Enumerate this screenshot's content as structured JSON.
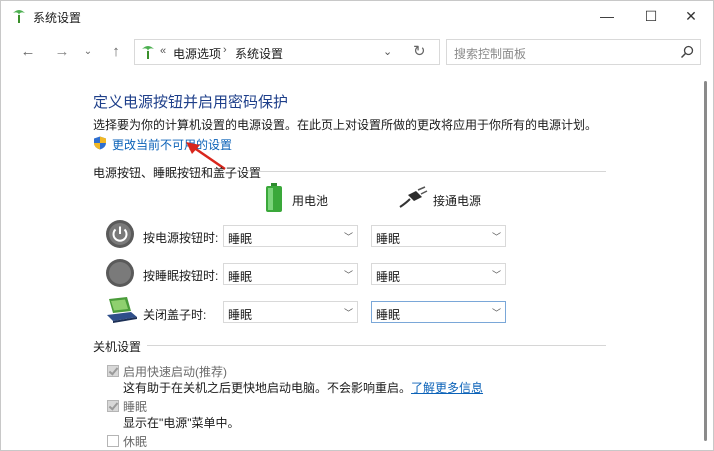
{
  "window": {
    "title": "系统设置"
  },
  "titlebar": {
    "minimize": "—",
    "maximize": "☐",
    "close": "✕"
  },
  "nav": {
    "back": "←",
    "forward": "→",
    "recent": "⌄",
    "up": "↑",
    "crumb_sep": "«",
    "crumb1": "电源选项",
    "chevron": "›",
    "crumb2": "系统设置",
    "dropdown": "⌄",
    "refresh": "↻",
    "search_placeholder": "搜索控制面板"
  },
  "page": {
    "title": "定义电源按钮并启用密码保护",
    "description": "选择要为你的计算机设置的电源设置。在此页上对设置所做的更改将应用于你所有的电源计划。",
    "change_link": "更改当前不可用的设置"
  },
  "buttons_group": {
    "title": "电源按钮、睡眠按钮和盖子设置",
    "col_battery": "用电池",
    "col_plugged": "接通电源",
    "rows": [
      {
        "label": "按电源按钮时:",
        "battery": "睡眠",
        "plugged": "睡眠"
      },
      {
        "label": "按睡眠按钮时:",
        "battery": "睡眠",
        "plugged": "睡眠"
      },
      {
        "label": "关闭盖子时:",
        "battery": "睡眠",
        "plugged": "睡眠"
      }
    ]
  },
  "shutdown_group": {
    "title": "关机设置",
    "options": [
      {
        "label": "启用快速启动(推荐)",
        "checked": true,
        "desc": "这有助于在关机之后更快地启动电脑。不会影响重启。",
        "link": "了解更多信息"
      },
      {
        "label": "睡眠",
        "checked": true,
        "desc": "显示在\"电源\"菜单中。"
      },
      {
        "label": "休眠",
        "checked": false
      }
    ]
  },
  "colors": {
    "title_blue": "#1e3f8a",
    "link_blue": "#0b62b8",
    "arrow_red": "#d9261c"
  }
}
